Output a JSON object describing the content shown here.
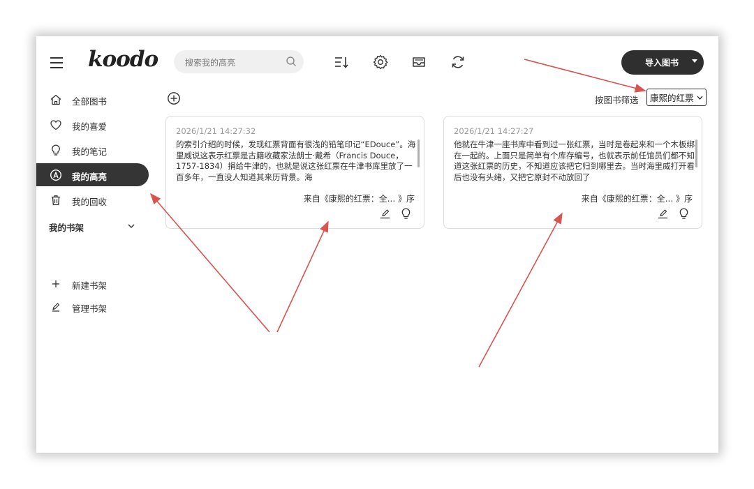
{
  "header": {
    "logo": "koodo",
    "search_placeholder": "搜索我的高亮",
    "import_label": "导入图书",
    "icons": [
      "menu-icon",
      "sort-icon",
      "gear-icon",
      "inbox-icon",
      "sync-icon"
    ]
  },
  "sidebar": {
    "items": [
      {
        "label": "全部图书",
        "icon": "home-icon"
      },
      {
        "label": "我的喜爱",
        "icon": "heart-icon"
      },
      {
        "label": "我的笔记",
        "icon": "bulb-icon"
      },
      {
        "label": "我的高亮",
        "icon": "highlight-icon",
        "active": true
      },
      {
        "label": "我的回收",
        "icon": "trash-icon"
      }
    ],
    "shelf_title": "我的书架",
    "shelf_actions": [
      {
        "label": "新建书架",
        "icon": "plus-icon"
      },
      {
        "label": "管理书架",
        "icon": "pencil-icon"
      }
    ]
  },
  "main": {
    "filter_label": "按图书筛选",
    "filter_value": "康熙的红票",
    "cards": [
      {
        "date": "2026/1/21 14:27:32",
        "text": "的索引介绍的时候，发现红票背面有很浅的铅笔印记“EDouce”。海里威说这表示红票是古籍收藏家法朗士·戴希（Francis Douce，1757-1834）捐给牛津的，也就是说这张红票在牛津书库里放了一百多年，一直没人知道其来历背景。海",
        "source": "来自《康熙的红票：全...  》序"
      },
      {
        "date": "2026/1/21 14:27:27",
        "text": "他就在牛津一座书库中看到过一张红票，当时是卷起来和一个木板绑在一起的。上面只是简单有个库存编号，也就表示前任馆员们都不知道这张红票的历史，不知道应该把它归到哪里去。当时海里威打开看后也没有头绪，又把它原封不动放回了",
        "source": "来自《康熙的红票：全...  》序"
      }
    ]
  },
  "colors": {
    "accent_dark": "#353535",
    "annotation_arrow": "#d9534f"
  }
}
